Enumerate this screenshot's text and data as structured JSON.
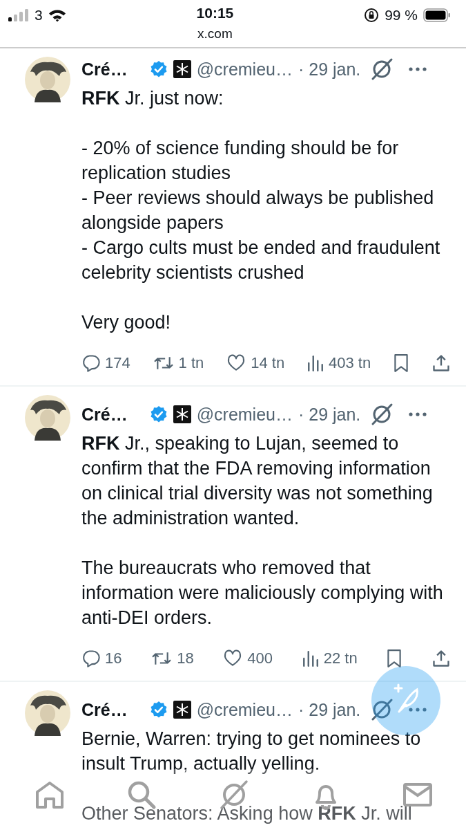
{
  "status_bar": {
    "carrier": "3",
    "time": "10:15",
    "battery": "99 %"
  },
  "address_bar": {
    "url": "x.com"
  },
  "tweets": [
    {
      "name": "Cré…",
      "handle": "@cremieu…",
      "date": "· 29 jan.",
      "paragraphs": [
        [
          "**RFK** Jr. just now:"
        ],
        [
          "- 20% of science funding should be for replication studies",
          "- Peer reviews should always be published alongside papers",
          "- Cargo cults must be ended and fraudulent celebrity scientists crushed"
        ],
        [
          "Very good!"
        ]
      ],
      "replies": "174",
      "reposts": "1 tn",
      "likes": "14 tn",
      "views": "403 tn"
    },
    {
      "name": "Cré…",
      "handle": "@cremieu…",
      "date": "· 29 jan.",
      "paragraphs": [
        [
          "**RFK** Jr., speaking to Lujan, seemed to confirm that the FDA removing information on clinical trial diversity was not something the administration wanted."
        ],
        [
          "The bureaucrats who removed that information were maliciously complying with anti-DEI orders."
        ]
      ],
      "replies": "16",
      "reposts": "18",
      "likes": "400",
      "views": "22 tn"
    },
    {
      "name": "Cré…",
      "handle": "@cremieu…",
      "date": "· 29 jan.",
      "paragraphs": [
        [
          "Bernie, Warren: trying to get nominees to insult Trump, actually yelling."
        ],
        [
          "Other Senators: Asking how **RFK** Jr. will"
        ]
      ]
    }
  ]
}
